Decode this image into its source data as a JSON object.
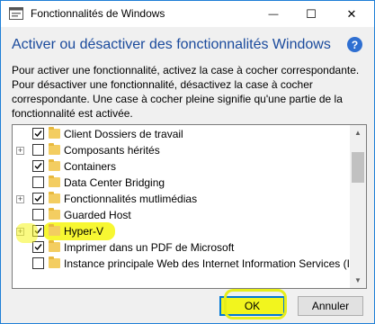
{
  "window": {
    "title": "Fonctionnalités de Windows",
    "accent_color": "#1a4a9c",
    "border_color": "#1f7fd6"
  },
  "titlebar": {
    "minimize_glyph": "—",
    "maximize_glyph": "☐",
    "close_glyph": "✕"
  },
  "header": {
    "title": "Activer ou désactiver des fonctionnalités Windows",
    "help_glyph": "?"
  },
  "description": "Pour activer une fonctionnalité, activez la case à cocher correspondante. Pour désactiver une fonctionnalité, désactivez la case à cocher correspondante. Une case à cocher pleine signifie qu'une partie de la fonctionnalité est activée.",
  "features": [
    {
      "label": "Client Dossiers de travail",
      "checked": true,
      "expandable": false
    },
    {
      "label": "Composants hérités",
      "checked": false,
      "expandable": true
    },
    {
      "label": "Containers",
      "checked": true,
      "expandable": false
    },
    {
      "label": "Data Center Bridging",
      "checked": false,
      "expandable": false
    },
    {
      "label": "Fonctionnalités mutlimédias",
      "checked": true,
      "expandable": true
    },
    {
      "label": "Guarded Host",
      "checked": false,
      "expandable": false
    },
    {
      "label": "Hyper-V",
      "checked": true,
      "expandable": true
    },
    {
      "label": "Imprimer dans un PDF de Microsoft",
      "checked": true,
      "expandable": false
    },
    {
      "label": "Instance principale Web des Internet Information Services (IIS",
      "checked": false,
      "expandable": false
    }
  ],
  "highlight_color": "#f6f61c",
  "buttons": {
    "ok": "OK",
    "cancel": "Annuler"
  }
}
